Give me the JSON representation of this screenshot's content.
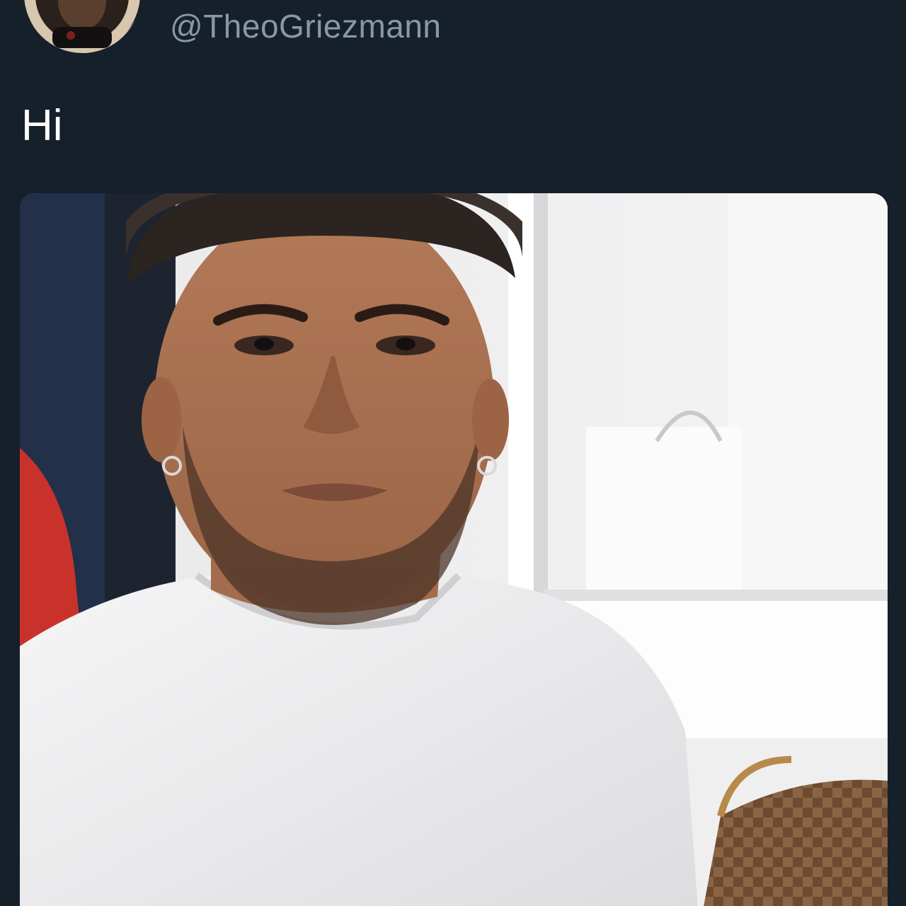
{
  "tweet": {
    "handle": "@TheoGriezmann",
    "text": "Hi",
    "avatar_icon": "profile-avatar",
    "media_icon": "selfie-photo"
  },
  "colors": {
    "background": "#15202b",
    "handle": "#8899a6",
    "text": "#ffffff"
  }
}
